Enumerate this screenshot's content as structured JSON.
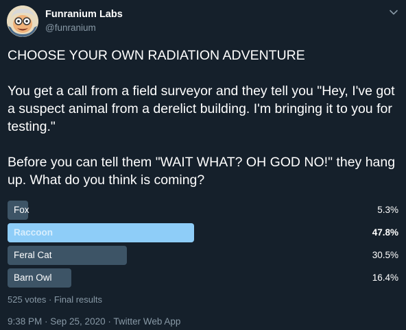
{
  "author": {
    "display_name": "Funranium Labs",
    "handle": "@funranium",
    "avatar_icon": "cartoon-scientist-avatar"
  },
  "tweet": {
    "text": "CHOOSE YOUR OWN RADIATION ADVENTURE\n\nYou get a call from a field surveyor and they tell you \"Hey, I've got a suspect animal from a derelict building. I'm bringing it to you for testing.\"\n\nBefore you can tell them \"WAIT WHAT? OH GOD NO!\" they hang up. What do you think is coming?"
  },
  "poll": {
    "options": [
      {
        "label": "Fox",
        "percent_text": "5.3%",
        "percent": 5.3,
        "winner": false
      },
      {
        "label": "Raccoon",
        "percent_text": "47.8%",
        "percent": 47.8,
        "winner": true
      },
      {
        "label": "Feral Cat",
        "percent_text": "30.5%",
        "percent": 30.5,
        "winner": false
      },
      {
        "label": "Barn Owl",
        "percent_text": "16.4%",
        "percent": 16.4,
        "winner": false
      }
    ],
    "meta": "525 votes · Final results"
  },
  "timestamp": "9:38 PM · Sep 25, 2020 · Twitter Web App",
  "colors": {
    "background": "#15202b",
    "bar": "#3d5466",
    "winner_bar": "#8ecdf8",
    "secondary_text": "#8899a6"
  }
}
